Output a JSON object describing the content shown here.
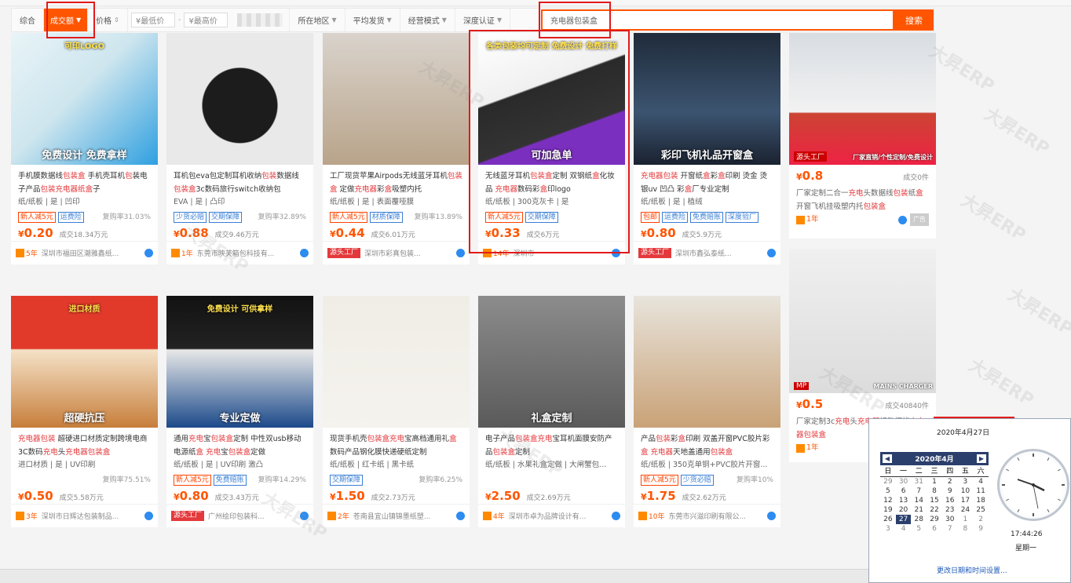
{
  "topstrip": [
    "  ",
    "  ",
    "  "
  ],
  "filters": {
    "sort_active": "成交额",
    "price_sort": "价格",
    "min_price": "¥最低价",
    "max_price": "¥最高价",
    "dash": "-",
    "location": "所在地区",
    "shipping": "平均发货",
    "business": "经营模式",
    "cert": "深度认证"
  },
  "search": {
    "value": "充电器包装盒",
    "button": "搜索"
  },
  "products": [
    {
      "img": "免费设计 免费拿样",
      "img2": "可印LOGO",
      "title": [
        [
          "手机膜数据线",
          ""
        ],
        [
          "包装盒",
          "hl"
        ],
        [
          " 手机壳耳机",
          ""
        ],
        [
          "包",
          "hl"
        ],
        [
          "装",
          ""
        ],
        [
          "电子产品",
          ""
        ],
        [
          "包装",
          "hl"
        ],
        [
          "充电器",
          "hl"
        ],
        [
          "纸",
          "hl"
        ],
        [
          "盒",
          "hl"
        ],
        [
          "子",
          ""
        ]
      ],
      "attr": "纸/纸板 | 是 | 凹印",
      "badges": [
        [
          "新人减5元",
          ""
        ],
        [
          "运费险",
          "blue"
        ]
      ],
      "rate": "复购率31.03%",
      "price": "0.20",
      "deal": "成交18.34万元",
      "shop_year": "5年",
      "shop": "深圳市福田区潮雅鑫纸...",
      "source": ""
    },
    {
      "img": "",
      "img2": "",
      "title": [
        [
          "耳机包eva包定制耳机收纳",
          ""
        ],
        [
          "包装",
          "hl"
        ],
        [
          "数据线",
          ""
        ],
        [
          "包装盒",
          "hl"
        ],
        [
          "3c数码旅行switch收纳包",
          ""
        ]
      ],
      "attr": "EVA | 是 | 凸印",
      "badges": [
        [
          "少货必赔",
          "blue"
        ],
        [
          "交期保障",
          "blue"
        ]
      ],
      "rate": "复购率32.89%",
      "price": "0.88",
      "deal": "成交9.46万元",
      "shop_year": "1年",
      "shop": "东莞市映芙箱包科技有...",
      "source": ""
    },
    {
      "img": "",
      "img2": "",
      "title": [
        [
          "工厂现货苹果Airpods无线蓝牙耳机",
          ""
        ],
        [
          "包装盒",
          "hl"
        ],
        [
          " 定做",
          ""
        ],
        [
          "充电器",
          "hl"
        ],
        [
          "彩",
          ""
        ],
        [
          "盒",
          "hl"
        ],
        [
          "吸塑内托",
          ""
        ]
      ],
      "attr": "纸/纸板 | 是 | 表面覆哑膜",
      "badges": [
        [
          "新人减5元",
          ""
        ],
        [
          "材质保障",
          "blue"
        ]
      ],
      "rate": "复购率13.89%",
      "price": "0.44",
      "deal": "成交6.01万元",
      "shop_year": "",
      "shop": "深圳市彩真包装...",
      "source": "源头工厂"
    },
    {
      "img": "可加急单",
      "img2": "各类包装均可定制 免费设计 免费打样",
      "title": [
        [
          "无线蓝牙耳机",
          ""
        ],
        [
          "包装盒",
          "hl"
        ],
        [
          "定制 双钢纸",
          ""
        ],
        [
          "盒",
          "hl"
        ],
        [
          "化妆品 ",
          ""
        ],
        [
          "充电器",
          "hl"
        ],
        [
          "数码彩",
          ""
        ],
        [
          "盒",
          "hl"
        ],
        [
          "印logo",
          ""
        ]
      ],
      "attr": "纸/纸板 | 300克灰卡 | 是",
      "badges": [
        [
          "新人减5元",
          ""
        ],
        [
          "交期保障",
          "blue"
        ]
      ],
      "rate": "",
      "price": "0.33",
      "deal": "成交6万元",
      "shop_year": "14年",
      "shop": "深圳市",
      "source": ""
    },
    {
      "img": "彩印飞机礼品开窗盒",
      "img2": "",
      "title": [
        [
          "充电器包装",
          "hl"
        ],
        [
          " 开窗纸",
          ""
        ],
        [
          "盒",
          "hl"
        ],
        [
          "彩",
          ""
        ],
        [
          "盒",
          "hl"
        ],
        [
          "印刷 烫金 烫银uv 凹凸 彩",
          ""
        ],
        [
          "盒",
          "hl"
        ],
        [
          "厂专业定制",
          ""
        ]
      ],
      "attr": "纸/纸板 | 是 | 植绒",
      "badges": [
        [
          "包邮",
          ""
        ],
        [
          "运费险",
          "blue"
        ],
        [
          "免费赔账",
          "blue"
        ],
        [
          "深度验厂",
          "blue"
        ]
      ],
      "rate": "",
      "price": "0.80",
      "deal": "成交5.9万元",
      "shop_year": "",
      "shop": "深圳市鑫弘泰纸...",
      "source": "源头工厂"
    },
    {
      "img": "",
      "img2": "",
      "title": [
        [
          "",
          ""
        ]
      ],
      "attr": "",
      "badges": [],
      "rate": "",
      "price": "",
      "deal": "",
      "shop_year": "",
      "shop": "",
      "source": ""
    },
    {
      "img": "超硬抗压",
      "img2": "进口材质",
      "title": [
        [
          "充电器包装",
          "hl"
        ],
        [
          " 超硬进口材质定制跨境电商3C数码",
          ""
        ],
        [
          "充电",
          "hl"
        ],
        [
          "头",
          ""
        ],
        [
          "充电器包装盒",
          "hl"
        ]
      ],
      "attr": "进口材质 | 是 | UV印刷",
      "badges": [],
      "rate": "复购率75.51%",
      "price": "0.50",
      "deal": "成交5.58万元",
      "shop_year": "3年",
      "shop": "深圳市日辉达包装制品...",
      "source": ""
    },
    {
      "img": "专业定做",
      "img2": "免费设计 可供拿样",
      "title": [
        [
          "通用",
          ""
        ],
        [
          "充电",
          "hl"
        ],
        [
          "宝",
          ""
        ],
        [
          "包装盒",
          "hl"
        ],
        [
          "定制 中性双usb移动电源纸",
          ""
        ],
        [
          "盒",
          "hl"
        ],
        [
          " ",
          ""
        ],
        [
          "充电",
          "hl"
        ],
        [
          "宝",
          ""
        ],
        [
          "包装盒",
          "hl"
        ],
        [
          "定做",
          ""
        ]
      ],
      "attr": "纸/纸板 | 是 | UV印刷 激凸",
      "badges": [
        [
          "新人减5元",
          ""
        ],
        [
          "免费赔账",
          "blue"
        ]
      ],
      "rate": "复购率14.29%",
      "price": "0.80",
      "deal": "成交3.43万元",
      "shop_year": "",
      "shop": "广州绘印包装科...",
      "source": "源头工厂"
    },
    {
      "img": "",
      "img2": "",
      "title": [
        [
          "现货手机壳",
          ""
        ],
        [
          "包装盒",
          "hl"
        ],
        [
          "充电",
          "hl"
        ],
        [
          "宝高档通用礼",
          ""
        ],
        [
          "盒",
          "hl"
        ],
        [
          "数码产品钢化膜快递硬纸定制",
          ""
        ]
      ],
      "attr": "纸/纸板 | 红卡纸 | 黑卡纸",
      "badges": [
        [
          "交期保障",
          "blue"
        ]
      ],
      "rate": "复购率6.25%",
      "price": "1.50",
      "deal": "成交2.73万元",
      "shop_year": "2年",
      "shop": "苍南县宜山镇锦墨纸塑...",
      "source": ""
    },
    {
      "img": "礼盒定制",
      "img2": "",
      "title": [
        [
          "电子产品",
          ""
        ],
        [
          "包装盒",
          "hl"
        ],
        [
          "充电",
          "hl"
        ],
        [
          "宝耳机面膜安防产品",
          ""
        ],
        [
          "包装盒",
          "hl"
        ],
        [
          "定制",
          ""
        ]
      ],
      "attr": "纸/纸板 | 水果礼盒定做 | 大闸蟹包...",
      "badges": [],
      "rate": "",
      "price": "2.50",
      "deal": "成交2.69万元",
      "shop_year": "4年",
      "shop": "深圳市卓为品牌设计有...",
      "source": ""
    },
    {
      "img": "",
      "img2": "",
      "title": [
        [
          "产品",
          ""
        ],
        [
          "包装",
          "hl"
        ],
        [
          "彩",
          ""
        ],
        [
          "盒",
          "hl"
        ],
        [
          "印刷 双盖开窗PVC胶片彩",
          ""
        ],
        [
          "盒",
          "hl"
        ],
        [
          " ",
          ""
        ],
        [
          "充电器",
          "hl"
        ],
        [
          "天地盖通用",
          ""
        ],
        [
          "包装盒",
          "hl"
        ]
      ],
      "attr": "纸/纸板 | 350克单铜+PVC胶片开窗...",
      "badges": [
        [
          "新人减5元",
          ""
        ],
        [
          "少货必赔",
          "blue"
        ]
      ],
      "rate": "复购率10%",
      "price": "1.75",
      "deal": "成交2.62万元",
      "shop_year": "10年",
      "shop": "东莞市兴滋印刷有限公...",
      "source": ""
    }
  ],
  "side": [
    {
      "price": "0.8",
      "deal": "成交0件",
      "title": [
        [
          "厂家定制二合一",
          ""
        ],
        [
          "充电",
          "hl"
        ],
        [
          "头数据线",
          ""
        ],
        [
          "包装",
          "hl"
        ],
        [
          "纸",
          ""
        ],
        [
          "盒",
          "hl"
        ],
        [
          "开窗飞机挂吸塑内托",
          ""
        ],
        [
          "包装盒",
          "hl"
        ]
      ],
      "year": "1年",
      "ad": "广告",
      "img": "源头工厂",
      "img2": "厂家直销/个性定制/免费设计"
    },
    {
      "price": "0.5",
      "deal": "成交40840件",
      "title": [
        [
          "厂家定制3c",
          ""
        ],
        [
          "充电",
          "hl"
        ],
        [
          "头",
          ""
        ],
        [
          "充电器",
          "hl"
        ],
        [
          "纸",
          ""
        ],
        [
          "数据线",
          ""
        ],
        [
          "充电器包装盒",
          "hl"
        ]
      ],
      "year": "1年",
      "img": "MP",
      "img2": "MAINS CHARGER"
    }
  ],
  "calendar": {
    "date_text": "2020年4月27日",
    "month": "2020年4月",
    "weekdays": [
      "日",
      "一",
      "二",
      "三",
      "四",
      "五",
      "六"
    ],
    "days": [
      [
        "29",
        "od"
      ],
      [
        "30",
        "od"
      ],
      [
        "31",
        "od"
      ],
      [
        "1",
        ""
      ],
      [
        "2",
        ""
      ],
      [
        "3",
        ""
      ],
      [
        "4",
        ""
      ],
      [
        "5",
        ""
      ],
      [
        "6",
        ""
      ],
      [
        "7",
        ""
      ],
      [
        "8",
        ""
      ],
      [
        "9",
        ""
      ],
      [
        "10",
        ""
      ],
      [
        "11",
        ""
      ],
      [
        "12",
        ""
      ],
      [
        "13",
        ""
      ],
      [
        "14",
        ""
      ],
      [
        "15",
        ""
      ],
      [
        "16",
        ""
      ],
      [
        "17",
        ""
      ],
      [
        "18",
        ""
      ],
      [
        "19",
        ""
      ],
      [
        "20",
        ""
      ],
      [
        "21",
        ""
      ],
      [
        "22",
        ""
      ],
      [
        "23",
        ""
      ],
      [
        "24",
        ""
      ],
      [
        "25",
        ""
      ],
      [
        "26",
        ""
      ],
      [
        "27",
        "sel"
      ],
      [
        "28",
        ""
      ],
      [
        "29",
        ""
      ],
      [
        "30",
        ""
      ],
      [
        "1",
        "od"
      ],
      [
        "2",
        "od"
      ],
      [
        "3",
        "od"
      ],
      [
        "4",
        "od"
      ],
      [
        "5",
        "od"
      ],
      [
        "6",
        "od"
      ],
      [
        "7",
        "od"
      ],
      [
        "8",
        "od"
      ],
      [
        "9",
        "od"
      ]
    ],
    "time": "17:44:26",
    "weekday_label": "星期一",
    "link": "更改日期和时间设置..."
  },
  "watermark": "大昇ERP",
  "colors": {
    "accent": "#ff5500",
    "highlight": "#e4393c",
    "annotation": "#e21a1a",
    "calendar_header": "#2b3f6c"
  }
}
